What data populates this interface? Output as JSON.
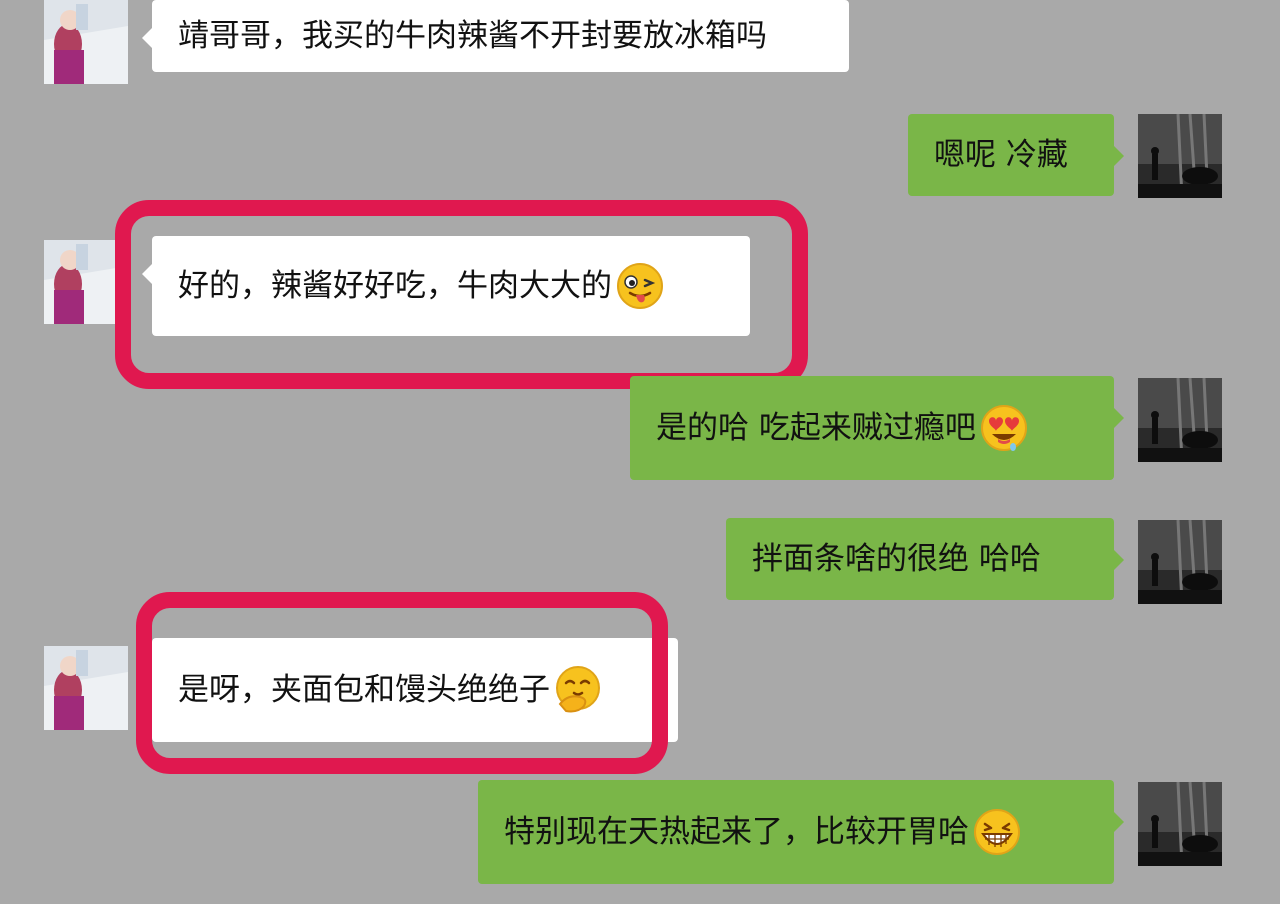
{
  "colors": {
    "background": "#a9a9a9",
    "incoming_bubble": "#ffffff",
    "outgoing_bubble": "#7ab648",
    "highlight_frame": "#e0184f"
  },
  "messages": [
    {
      "side": "left",
      "text": "靖哥哥，我买的牛肉辣酱不开封要放冰箱吗",
      "emoji": ""
    },
    {
      "side": "right",
      "text": "嗯呢  冷藏",
      "emoji": ""
    },
    {
      "side": "left",
      "text": "好的，辣酱好好吃，牛肉大大的",
      "emoji": "winking-tongue-face-icon",
      "highlighted": true
    },
    {
      "side": "right",
      "text": "是的哈  吃起来贼过瘾吧",
      "emoji": "heart-eyes-drooling-face-icon"
    },
    {
      "side": "right",
      "text": "拌面条啥的很绝   哈哈",
      "emoji": ""
    },
    {
      "side": "left",
      "text": "是呀，夹面包和馒头绝绝子",
      "emoji": "thinking-face-icon",
      "highlighted": true
    },
    {
      "side": "right",
      "text": "特别现在天热起来了，比较开胃哈",
      "emoji": "grinning-face-icon"
    }
  ]
}
